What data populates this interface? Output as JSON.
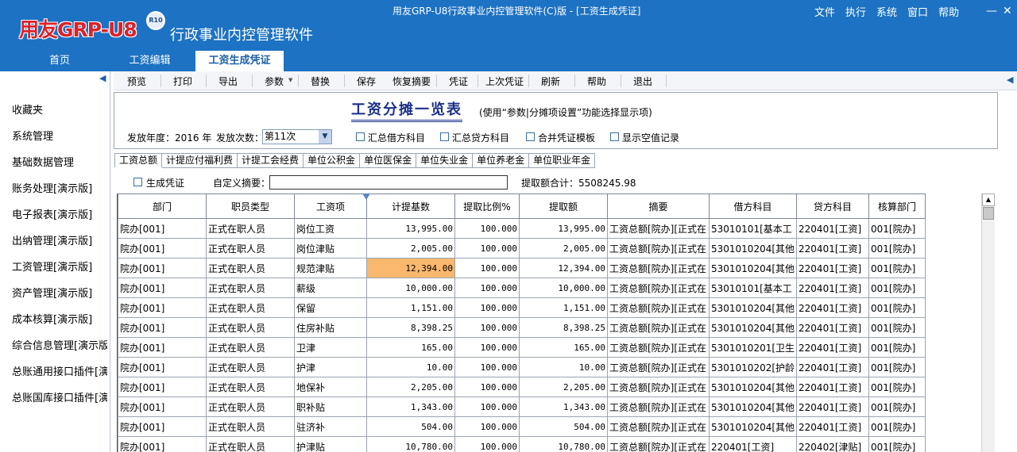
{
  "header": {
    "logo_text": "用友GRP-U8",
    "logo_badge": "R10",
    "app_subtitle": "行政事业内控管理软件",
    "window_title": "用友GRP-U8行政事业内控管理软件(C)版 - [工资生成凭证]",
    "menu": [
      "文件",
      "执行",
      "系统",
      "窗口",
      "帮助"
    ],
    "minimize": "—",
    "close": "✕"
  },
  "nav_tabs": [
    "首页",
    "工资编辑",
    "工资生成凭证"
  ],
  "sidebar": {
    "collapse": "◀",
    "items": [
      "收藏夹",
      "系统管理",
      "基础数据管理",
      "账务处理[演示版]",
      "电子报表[演示版]",
      "出纳管理[演示版]",
      "工资管理[演示版]",
      "资产管理[演示版]",
      "成本核算[演示版]",
      "综合信息管理[演示版]",
      "总账通用接口插件[演示版]",
      "总账国库接口插件[演示版]"
    ]
  },
  "toolbar": {
    "buttons": [
      "预览",
      "打印",
      "导出",
      "参数",
      "替换",
      "保存",
      "恢复摘要",
      "凭证",
      "上次凭证",
      "刷新",
      "帮助",
      "退出"
    ],
    "param_arrow": "▼",
    "collapse": "◀"
  },
  "panel": {
    "title": "工资分摊一览表",
    "note": "(使用“参数|分摊项设置”功能选择显示项)",
    "year_label": "发放年度：2016 年",
    "times_label": "发放次数：",
    "times_value": "第11次",
    "checkboxes": [
      "汇总借方科目",
      "汇总贷方科目",
      "合并凭证模板",
      "显示空值记录"
    ]
  },
  "sub_tabs": [
    "工资总额",
    "计提应付福利费",
    "计提工会经费",
    "单位公积金",
    "单位医保金",
    "单位失业金",
    "单位养老金",
    "单位职业年金"
  ],
  "gen_row": {
    "generate_label": "生成凭证",
    "memo_label": "自定义摘要：",
    "memo_value": "",
    "total_label": "提取额合计：5508245.98"
  },
  "grid": {
    "columns": [
      "部门",
      "职员类型",
      "工资项",
      "计提基数",
      "提取比例%",
      "提取额",
      "摘要",
      "借方科目",
      "贷方科目",
      "核算部门"
    ],
    "rows": [
      [
        "院办[001]",
        "正式在职人员",
        "岗位工资",
        "13,995.00",
        "100.000",
        "13,995.00",
        "工资总额[院办][正式在",
        "53010101[基本工",
        "220401[工资]",
        "001[院办]"
      ],
      [
        "院办[001]",
        "正式在职人员",
        "岗位津贴",
        "2,005.00",
        "100.000",
        "2,005.00",
        "工资总额[院办][正式在",
        "5301010204[其他",
        "220401[工资]",
        "001[院办]"
      ],
      [
        "院办[001]",
        "正式在职人员",
        "规范津贴",
        "12,394.00",
        "100.000",
        "12,394.00",
        "工资总额[院办][正式在",
        "5301010204[其他",
        "220401[工资]",
        "001[院办]"
      ],
      [
        "院办[001]",
        "正式在职人员",
        "薪级",
        "10,000.00",
        "100.000",
        "10,000.00",
        "工资总额[院办][正式在",
        "53010101[基本工",
        "220401[工资]",
        "001[院办]"
      ],
      [
        "院办[001]",
        "正式在职人员",
        "保留",
        "1,151.00",
        "100.000",
        "1,151.00",
        "工资总额[院办][正式在",
        "5301010204[其他",
        "220401[工资]",
        "001[院办]"
      ],
      [
        "院办[001]",
        "正式在职人员",
        "住房补贴",
        "8,398.25",
        "100.000",
        "8,398.25",
        "工资总额[院办][正式在",
        "5301010204[其他",
        "220401[工资]",
        "001[院办]"
      ],
      [
        "院办[001]",
        "正式在职人员",
        "卫津",
        "165.00",
        "100.000",
        "165.00",
        "工资总额[院办][正式在",
        "5301010201[卫生",
        "220401[工资]",
        "001[院办]"
      ],
      [
        "院办[001]",
        "正式在职人员",
        "护津",
        "10.00",
        "100.000",
        "10.00",
        "工资总额[院办][正式在",
        "5301010202[护龄",
        "220401[工资]",
        "001[院办]"
      ],
      [
        "院办[001]",
        "正式在职人员",
        "地保补",
        "2,205.00",
        "100.000",
        "2,205.00",
        "工资总额[院办][正式在",
        "5301010204[其他",
        "220401[工资]",
        "001[院办]"
      ],
      [
        "院办[001]",
        "正式在职人员",
        "职补贴",
        "1,343.00",
        "100.000",
        "1,343.00",
        "工资总额[院办][正式在",
        "5301010204[其他",
        "220401[工资]",
        "001[院办]"
      ],
      [
        "院办[001]",
        "正式在职人员",
        "驻济补",
        "504.00",
        "100.000",
        "504.00",
        "工资总额[院办][正式在",
        "5301010204[其他",
        "220401[工资]",
        "001[院办]"
      ],
      [
        "院办[001]",
        "正式在职人员",
        "护津贴",
        "10,780.00",
        "100.000",
        "10,780.00",
        "工资总额[院办][正式在",
        "220401[工资]",
        "220402[津贴]",
        "001[院办]"
      ]
    ],
    "selected_cell": "2-3"
  },
  "colors": {
    "header_bg": "#1d72c3",
    "selected_cell": "#f9b86e",
    "title_ink": "#1b2f8a"
  }
}
